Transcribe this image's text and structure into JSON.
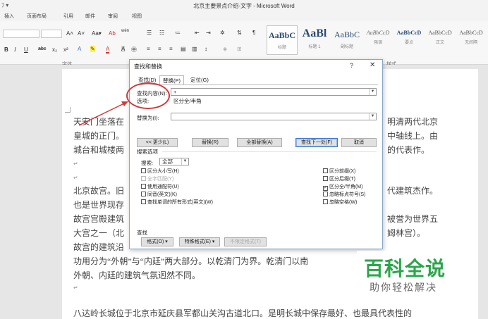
{
  "window": {
    "title": "北京主要景点介绍-文字 - Microsoft Word",
    "qat": "ﾌ ▾"
  },
  "ribbon_tabs": [
    "插入",
    "页面布局",
    "引用",
    "邮件",
    "审阅",
    "视图"
  ],
  "ribbon": {
    "font_size_value": "",
    "grow_font": "A˄",
    "shrink_font": "A˅",
    "change_case": "Aa▾",
    "clear_format": "Ab",
    "wen_label": "wén",
    "bold": "B",
    "italic": "I",
    "underline": "U",
    "strike": "abc",
    "subscript": "x₂",
    "superscript": "x²",
    "font_group_label": "字体",
    "styles_group_label": "样式",
    "styles": [
      {
        "sample": "AaBbC",
        "name": "标题"
      },
      {
        "sample": "AaBl",
        "name": "标题 1"
      },
      {
        "sample": "AaBbC",
        "name": "副标题"
      },
      {
        "sample": "AaBbCcD",
        "name": "强调"
      },
      {
        "sample": "AaBbCcD",
        "name": "要点"
      },
      {
        "sample": "AaBbCcD",
        "name": "正文"
      },
      {
        "sample": "AaBbCcD",
        "name": "无间隔"
      }
    ]
  },
  "document": {
    "lines": [
      "天安门坐落在",
      "皇城的正门。",
      "城台和城楼两",
      "北京故宫。旧",
      "也是世界现存",
      "故宫宫殿建筑",
      "大宫之一（北",
      "故宫的建筑沿",
      "功用分为“外朝”与“内廷”两大部分。以乾清门为界。乾清门以南",
      "外朝、内廷的建筑气氛迥然不同。",
      "八达岭长城位于北京市延庆县军都山关沟古道北口。是明长城中保存最好、也最具代表性的"
    ],
    "right_fragments": [
      "明清两代北京",
      "中轴线上。由",
      "的代表作。",
      "代建筑杰作。",
      "被誉为世界五",
      "姆林宫）。"
    ],
    "para_mark": "↵"
  },
  "dialog": {
    "title": "查找和替换",
    "help": "?",
    "close": "✕",
    "tabs": [
      "查找(D)",
      "替换(P)",
      "定位(G)"
    ],
    "find_label": "查找内容(N):",
    "find_value": "+",
    "options_label": "选项:",
    "options_value": "区分全/半角",
    "replace_label": "替换为(I):",
    "replace_value": "",
    "less_button": "<< 更少(L)",
    "replace_button": "替换(R)",
    "replace_all_button": "全部替换(A)",
    "find_next_button": "查找下一处(F)",
    "cancel_button": "取消",
    "search_options_heading": "搜索选项",
    "search_label": "搜索:",
    "search_value": "全部",
    "left_options": [
      {
        "label": "区分大小写(H)",
        "checked": false,
        "disabled": false
      },
      {
        "label": "全字匹配(Y)",
        "checked": false,
        "disabled": true
      },
      {
        "label": "使用通配符(U)",
        "checked": false,
        "disabled": false
      },
      {
        "label": "同音(英文)(K)",
        "checked": false,
        "disabled": false
      },
      {
        "label": "查找单词的所有形式(英文)(W)",
        "checked": false,
        "disabled": false
      }
    ],
    "right_options": [
      {
        "label": "区分前缀(X)",
        "checked": false,
        "disabled": false
      },
      {
        "label": "区分后缀(T)",
        "checked": false,
        "disabled": false
      },
      {
        "label": "区分全/半角(M)",
        "checked": true,
        "disabled": false
      },
      {
        "label": "忽略标点符号(S)",
        "checked": false,
        "disabled": false
      },
      {
        "label": "忽略空格(W)",
        "checked": false,
        "disabled": false
      }
    ],
    "find_section_label": "查找",
    "format_button": "格式(O) ▾",
    "special_button": "特殊格式(E) ▾",
    "no_format_button": "不限定格式(T)"
  },
  "watermark": {
    "main": "百科全说",
    "sub": "助你轻松解决"
  },
  "colors": {
    "annotation_red": "#d23a3a",
    "watermark_green": "#2aa64a"
  }
}
